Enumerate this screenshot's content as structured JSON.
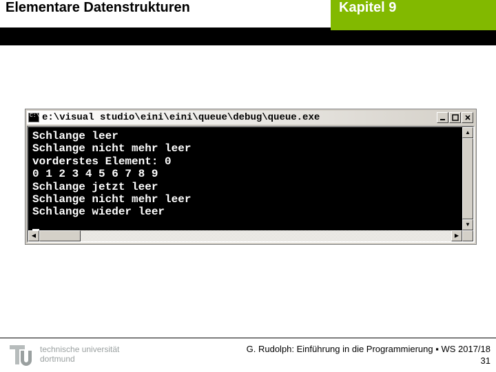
{
  "header": {
    "left": "Elementare Datenstrukturen",
    "right": "Kapitel 9"
  },
  "console": {
    "title_prefix": "e:\\visual studio\\eini\\eini\\queue\\debug\\queue.exe",
    "lines": [
      "Schlange leer",
      "Schlange nicht mehr leer",
      "vorderstes Element: 0",
      "0 1 2 3 4 5 6 7 8 9",
      "Schlange jetzt leer",
      "Schlange nicht mehr leer",
      "Schlange wieder leer"
    ]
  },
  "logo": {
    "line1": "technische universität",
    "line2": "dortmund"
  },
  "footer": {
    "credit": "G. Rudolph: Einführung in die Programmierung ▪ WS 2017/18",
    "page": "31"
  }
}
